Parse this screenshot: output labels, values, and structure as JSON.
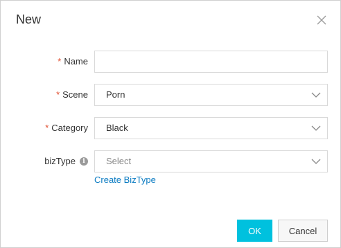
{
  "dialog": {
    "title": "New",
    "close_icon": "close-icon"
  },
  "form": {
    "required_mark": "*",
    "name": {
      "label": "Name",
      "value": "",
      "placeholder": ""
    },
    "scene": {
      "label": "Scene",
      "value": "Porn"
    },
    "category": {
      "label": "Category",
      "value": "Black"
    },
    "biztype": {
      "label": "bizType",
      "placeholder": "Select",
      "info_icon": "info-icon",
      "info_glyph": "i"
    },
    "create_link": "Create BizType"
  },
  "buttons": {
    "ok_label": "OK",
    "cancel_label": "Cancel"
  },
  "colors": {
    "accent": "#00c1de",
    "link": "#0a7bc2",
    "required": "#e04c2d"
  }
}
